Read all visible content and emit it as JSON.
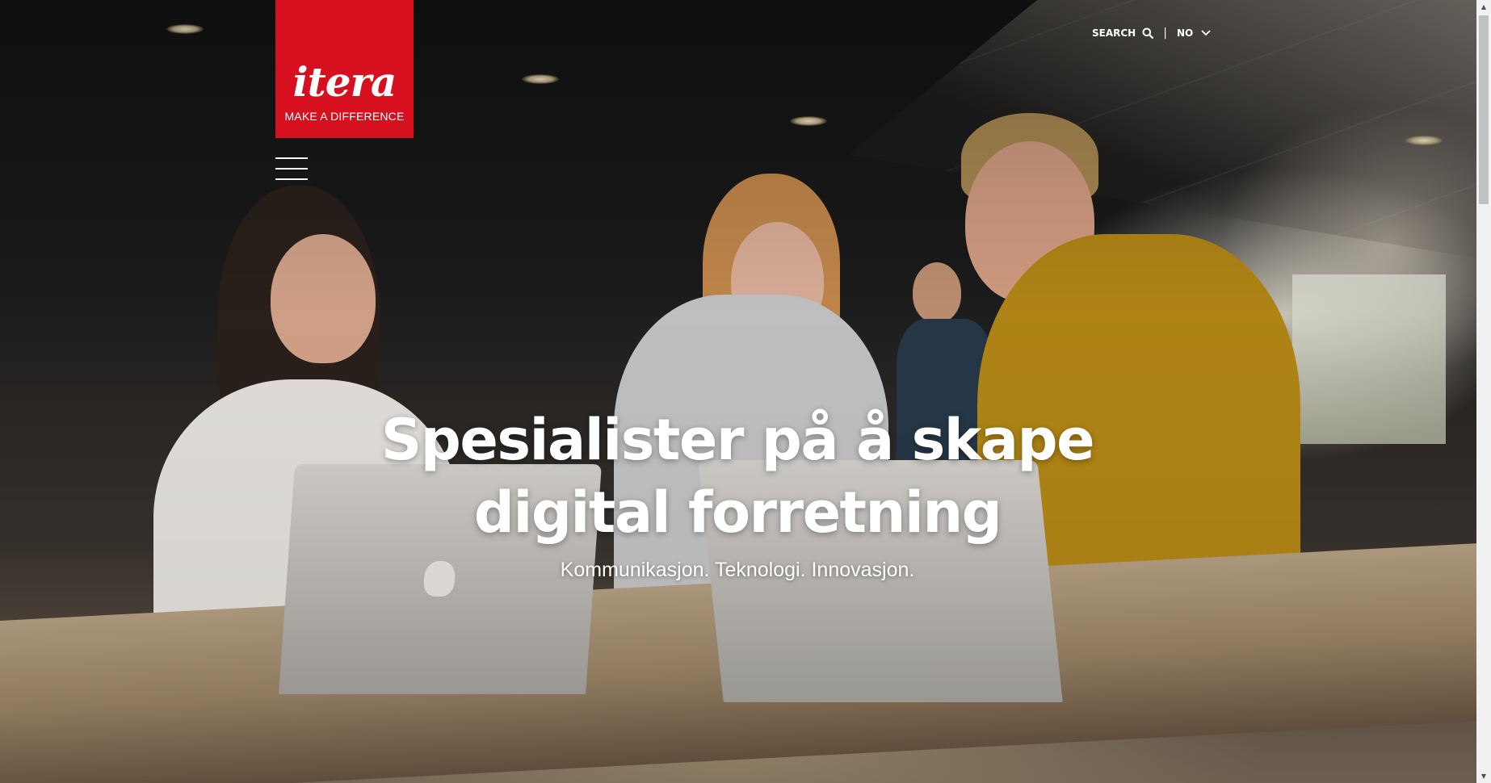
{
  "brand": {
    "wordmark": "itera",
    "tagline": "MAKE A DIFFERENCE",
    "color": "#d7101f"
  },
  "menu": {
    "icon": "hamburger-menu-icon"
  },
  "utility_nav": {
    "search_label": "SEARCH",
    "search_icon": "search-icon",
    "separator": "|",
    "language_label": "NO",
    "language_icon": "chevron-down-icon"
  },
  "hero": {
    "headline_line1": "Spesialister på å skape",
    "headline_line2": "digital forretning",
    "subline": "Kommunikasjon. Teknologi. Innovasjon.",
    "image": "office-team-photo"
  },
  "scrollbar": {
    "up_icon": "scroll-up-icon",
    "down_icon": "scroll-down-icon"
  }
}
